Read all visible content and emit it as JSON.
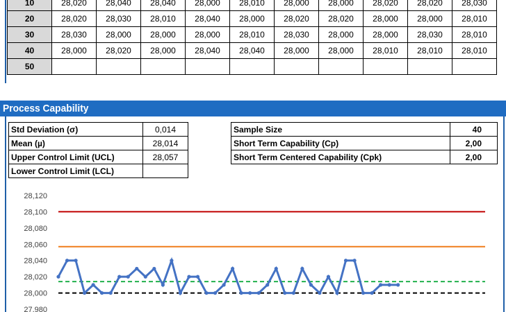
{
  "grid": {
    "rows": [
      {
        "label": "10",
        "values": [
          "28,020",
          "28,040",
          "28,040",
          "28,000",
          "28,010",
          "28,000",
          "28,000",
          "28,020",
          "28,020",
          "28,030"
        ]
      },
      {
        "label": "20",
        "values": [
          "28,020",
          "28,030",
          "28,010",
          "28,040",
          "28,000",
          "28,020",
          "28,020",
          "28,000",
          "28,000",
          "28,010"
        ]
      },
      {
        "label": "30",
        "values": [
          "28,030",
          "28,000",
          "28,000",
          "28,000",
          "28,010",
          "28,030",
          "28,000",
          "28,000",
          "28,030",
          "28,010"
        ]
      },
      {
        "label": "40",
        "values": [
          "28,000",
          "28,020",
          "28,000",
          "28,040",
          "28,040",
          "28,000",
          "28,000",
          "28,010",
          "28,010",
          "28,010"
        ]
      },
      {
        "label": "50",
        "values": [
          "",
          "",
          "",
          "",
          "",
          "",
          "",
          "",
          "",
          ""
        ]
      }
    ]
  },
  "section": {
    "title": "Process Capability"
  },
  "stats_left": [
    {
      "label": "Std Deviation (σ)",
      "value": "0,014"
    },
    {
      "label": "Mean (µ)",
      "value": "28,014"
    },
    {
      "label": "Upper Control Limit (UCL)",
      "value": "28,057"
    },
    {
      "label": "Lower Control Limit (LCL)",
      "value": ""
    }
  ],
  "stats_right": [
    {
      "label": "Sample Size",
      "value": "40"
    },
    {
      "label": "Short Term Capability (Cp)",
      "value": "2,00"
    },
    {
      "label": "Short Term Centered Capability (Cpk)",
      "value": "2,00"
    }
  ],
  "chart_data": {
    "type": "line",
    "y_ticks": [
      "28,120",
      "28,100",
      "28,080",
      "28,060",
      "28,040",
      "28,020",
      "28,000",
      "27,980"
    ],
    "ylim": [
      27.98,
      28.12
    ],
    "series": [
      {
        "values": [
          28.02,
          28.04,
          28.04,
          28.0,
          28.01,
          28.0,
          28.0,
          28.02,
          28.02,
          28.03,
          28.02,
          28.03,
          28.01,
          28.04,
          28.0,
          28.02,
          28.02,
          28.0,
          28.0,
          28.01,
          28.03,
          28.0,
          28.0,
          28.0,
          28.01,
          28.03,
          28.0,
          28.0,
          28.03,
          28.01,
          28.0,
          28.02,
          28.0,
          28.04,
          28.04,
          28.0,
          28.0,
          28.01,
          28.01,
          28.01
        ],
        "color": "#4472c4"
      }
    ],
    "ref_lines": [
      {
        "value": 28.1,
        "color": "#c00000",
        "style": "solid"
      },
      {
        "value": 28.057,
        "color": "#f07d1a",
        "style": "solid"
      },
      {
        "value": 28.014,
        "color": "#22b14c",
        "style": "dashed"
      },
      {
        "value": 28.0,
        "color": "#000000",
        "style": "dashed"
      }
    ],
    "n_points": 50
  }
}
